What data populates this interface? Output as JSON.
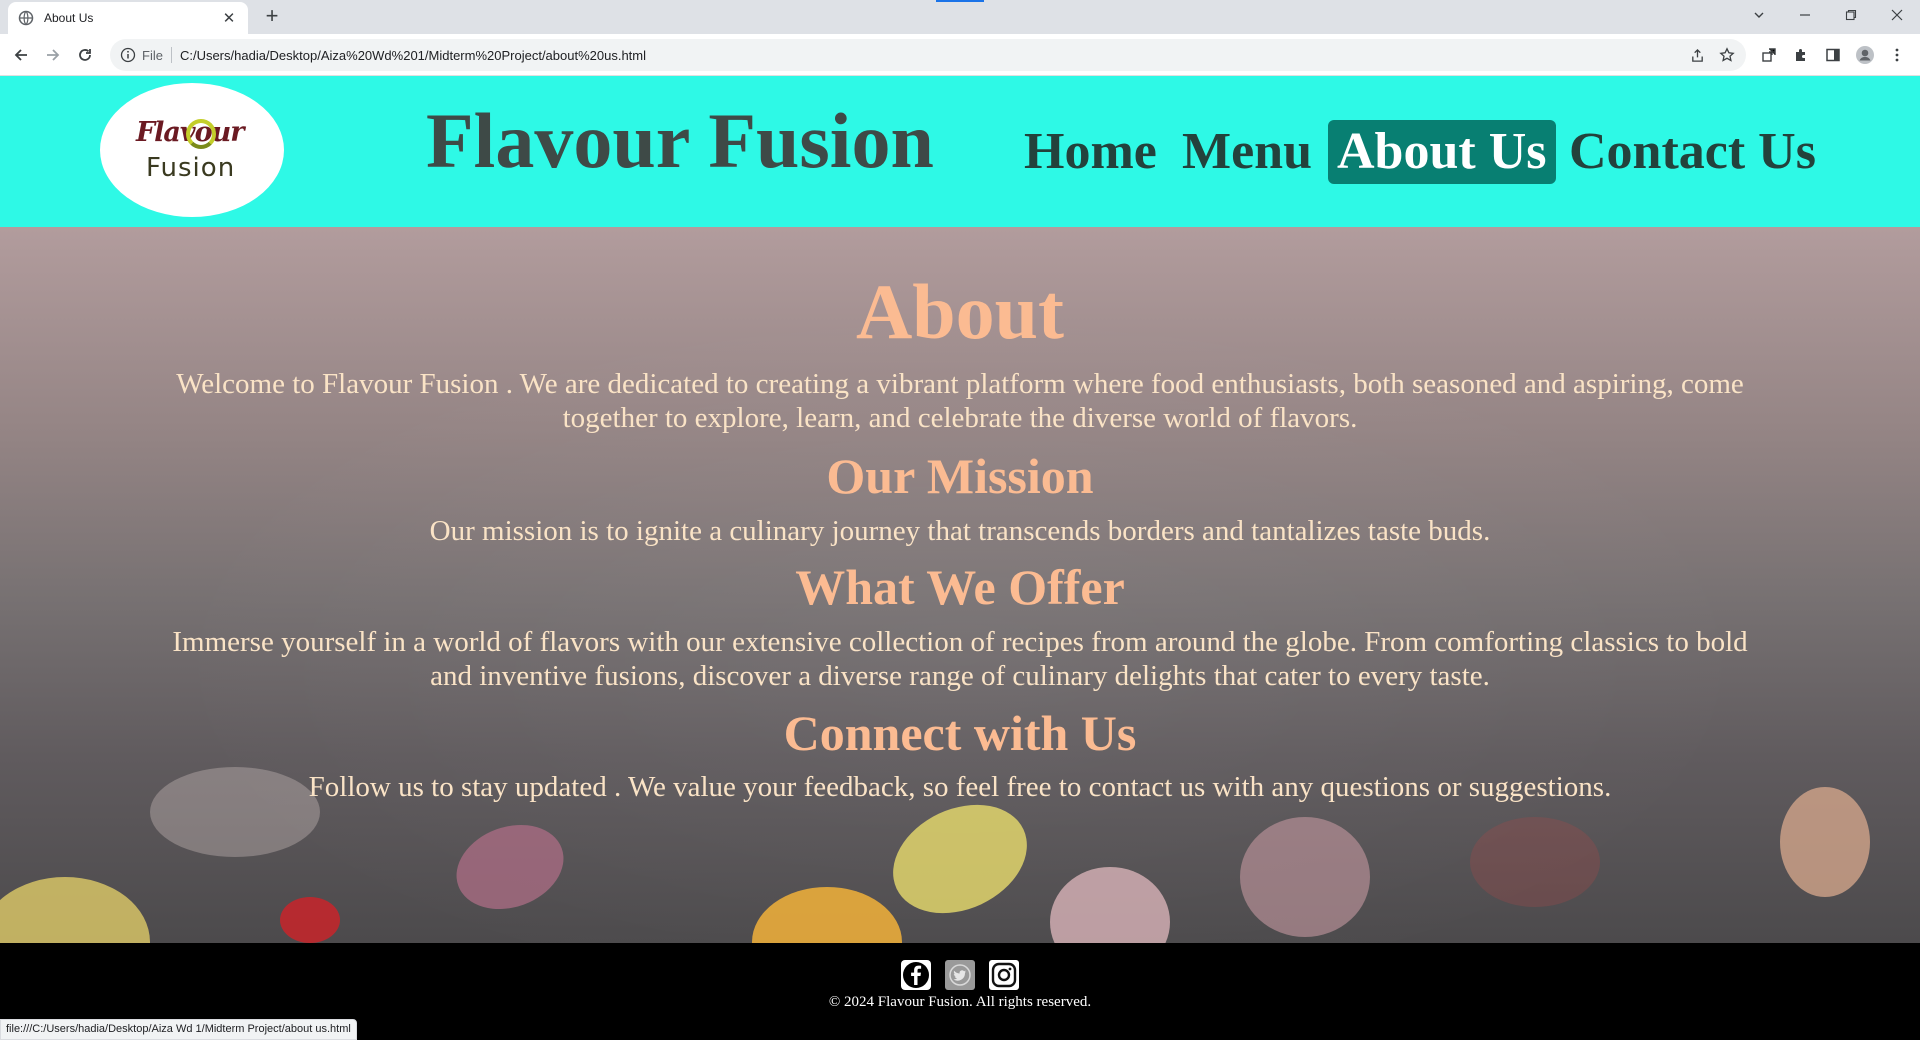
{
  "browser": {
    "tab_title": "About Us",
    "url_scheme": "File",
    "url": "C:/Users/hadia/Desktop/Aiza%20Wd%201/Midterm%20Project/about%20us.html",
    "status_url": "file:///C:/Users/hadia/Desktop/Aiza Wd 1/Midterm Project/about us.html"
  },
  "header": {
    "logo_line1": "Flavour",
    "logo_line2": "Fusion",
    "site_title": "Flavour Fusion",
    "nav": [
      {
        "label": "Home"
      },
      {
        "label": "Menu"
      },
      {
        "label": "About Us"
      },
      {
        "label": "Contact Us"
      }
    ]
  },
  "main": {
    "title": "About",
    "intro": "Welcome to Flavour Fusion . We are dedicated to creating a vibrant platform where food enthusiasts, both seasoned and aspiring, come together to explore, learn, and celebrate the diverse world of flavors.",
    "sections": [
      {
        "heading": "Our Mission",
        "text": "Our mission is to ignite a culinary journey that transcends borders and tantalizes taste buds."
      },
      {
        "heading": "What We Offer",
        "text": "Immerse yourself in a world of flavors with our extensive collection of recipes from around the globe. From comforting classics to bold and inventive fusions, discover a diverse range of culinary delights that cater to every taste."
      },
      {
        "heading": "Connect with Us",
        "text": "Follow us to stay updated . We value your feedback, so feel free to contact us with any questions or suggestions."
      }
    ]
  },
  "footer": {
    "social": [
      "facebook-icon",
      "twitter-icon",
      "instagram-icon"
    ],
    "copyright": "© 2024 Flavour Fusion. All rights reserved."
  },
  "colors": {
    "header_bg": "#2ef9e6",
    "nav_active_bg": "#087f72",
    "heading": "#fbbb92",
    "body_text": "#fae3c6"
  }
}
